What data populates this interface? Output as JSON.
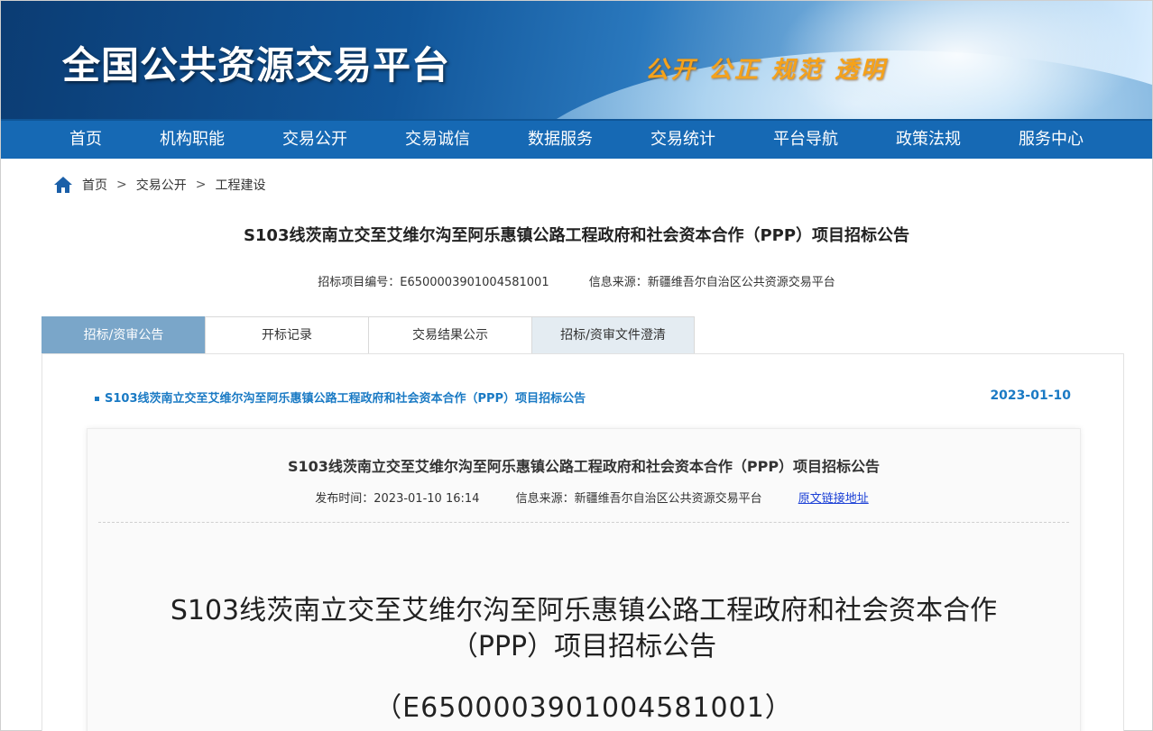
{
  "banner": {
    "logo_title": "全国公共资源交易平台",
    "slogan": "公开 公正 规范 透明"
  },
  "nav": {
    "items": [
      "首页",
      "机构职能",
      "交易公开",
      "交易诚信",
      "数据服务",
      "交易统计",
      "平台导航",
      "政策法规",
      "服务中心"
    ]
  },
  "breadcrumb": {
    "items": [
      "首页",
      "交易公开",
      "工程建设"
    ],
    "separator": ">"
  },
  "page": {
    "title": "S103线茨南立交至艾维尔沟至阿乐惠镇公路工程政府和社会资本合作（PPP）项目招标公告",
    "project_no": "招标项目编号：E6500003901004581001",
    "source": "信息来源：新疆维吾尔自治区公共资源交易平台"
  },
  "tabs": [
    {
      "label": "招标/资审公告",
      "active": true
    },
    {
      "label": "开标记录",
      "active": false
    },
    {
      "label": "交易结果公示",
      "active": false
    },
    {
      "label": "招标/资审文件澄清",
      "active": false
    }
  ],
  "notice": {
    "title": "S103线茨南立交至艾维尔沟至阿乐惠镇公路工程政府和社会资本合作（PPP）项目招标公告",
    "date": "2023-01-10"
  },
  "card": {
    "title": "S103线茨南立交至艾维尔沟至阿乐惠镇公路工程政府和社会资本合作（PPP）项目招标公告",
    "publish_time": "发布时间：2023-01-10 16:14",
    "source": "信息来源：新疆维吾尔自治区公共资源交易平台",
    "original_link": "原文链接地址",
    "doc_title_line1": "S103线茨南立交至艾维尔沟至阿乐惠镇公路工程政府和社会资本合作",
    "doc_title_line2": "（PPP）项目招标公告",
    "doc_code": "（E6500003901004581001）"
  },
  "colors": {
    "nav_bg": "#1669b4",
    "active_tab": "#7aa6c9",
    "notice_blue": "#1a7ac4",
    "slogan": "#f5a21b"
  }
}
